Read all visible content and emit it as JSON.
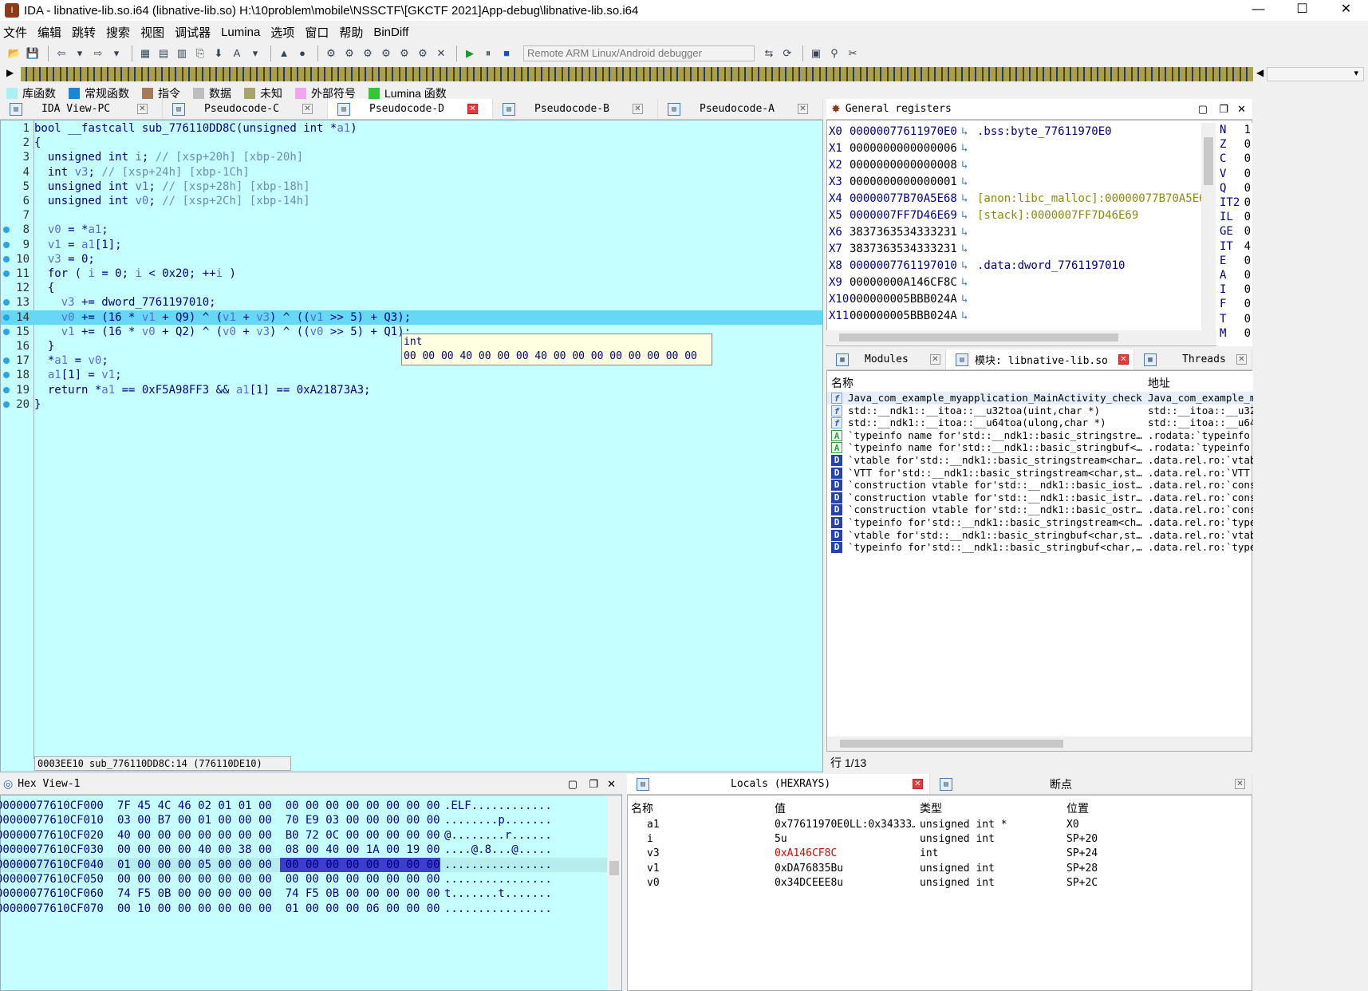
{
  "window": {
    "title": "IDA - libnative-lib.so.i64 (libnative-lib.so) H:\\10problem\\mobile\\NSSCTF\\[GKCTF 2021]App-debug\\libnative-lib.so.i64",
    "minimize": "—",
    "maximize": "☐",
    "close": "✕"
  },
  "menu": [
    "文件",
    "编辑",
    "跳转",
    "搜索",
    "视图",
    "调试器",
    "Lumina",
    "选项",
    "窗口",
    "帮助",
    "BinDiff"
  ],
  "debugger_select": "Remote ARM Linux/Android debugger",
  "legend": [
    {
      "label": "库函数",
      "color": "#aaf0f4"
    },
    {
      "label": "常规函数",
      "color": "#1a86d8"
    },
    {
      "label": "指令",
      "color": "#a67a55"
    },
    {
      "label": "数据",
      "color": "#bdbdbd"
    },
    {
      "label": "未知",
      "color": "#a7a467"
    },
    {
      "label": "外部符号",
      "color": "#f3a4f0"
    },
    {
      "label": "Lumina 函数",
      "color": "#32c832"
    }
  ],
  "code_tabs": [
    {
      "label": "IDA View-PC"
    },
    {
      "label": "Pseudocode-C"
    },
    {
      "label": "Pseudocode-D",
      "active": true
    },
    {
      "label": "Pseudocode-B"
    },
    {
      "label": "Pseudocode-A"
    }
  ],
  "code": {
    "lines": [
      {
        "n": "1",
        "text": "bool __fastcall sub_776110DD8C(unsigned int *a1)"
      },
      {
        "n": "2",
        "text": "{"
      },
      {
        "n": "3",
        "text": "  unsigned int i; // [xsp+20h] [xbp-20h]"
      },
      {
        "n": "4",
        "text": "  int v3; // [xsp+24h] [xbp-1Ch]"
      },
      {
        "n": "5",
        "text": "  unsigned int v1; // [xsp+28h] [xbp-18h]"
      },
      {
        "n": "6",
        "text": "  unsigned int v0; // [xsp+2Ch] [xbp-14h]"
      },
      {
        "n": "7",
        "text": ""
      },
      {
        "n": "8",
        "text": "  v0 = *a1;",
        "bp": true
      },
      {
        "n": "9",
        "text": "  v1 = a1[1];",
        "bp": true
      },
      {
        "n": "10",
        "text": "  v3 = 0;",
        "bp": true
      },
      {
        "n": "11",
        "text": "  for ( i = 0; i < 0x20; ++i )",
        "bp": true
      },
      {
        "n": "12",
        "text": "  {"
      },
      {
        "n": "13",
        "text": "    v3 += dword_7761197010;",
        "bp": true
      },
      {
        "n": "14",
        "text": "    v0 += (16 * v1 + Q9) ^ (v1 + v3) ^ ((v1 >> 5) + Q3);",
        "bp": true,
        "hl": true
      },
      {
        "n": "15",
        "text": "    v1 += (16 * v0 + Q2) ^ (v0 + v3) ^ ((v0 >> 5) + Q1);",
        "bp": true
      },
      {
        "n": "16",
        "text": "  }"
      },
      {
        "n": "17",
        "text": "  *a1 = v0;",
        "bp": true
      },
      {
        "n": "18",
        "text": "  a1[1] = v1;",
        "bp": true
      },
      {
        "n": "19",
        "text": "  return *a1 == 0xF5A98FF3 && a1[1] == 0xA21873A3;",
        "bp": true
      },
      {
        "n": "20",
        "text": "}",
        "bp": true
      }
    ],
    "tooltip_type": "int",
    "tooltip_bytes": "00 00 00 40 00 00 00 40 00 00 00 00 00 00 00 00",
    "status": "0003EE10 sub_776110DD8C:14 (776110DE10)"
  },
  "registers": {
    "title": "General registers",
    "rows": [
      {
        "name": "X0",
        "value": "00000077611970E0",
        "target": ".bss:byte_77611970E0"
      },
      {
        "name": "X1",
        "value": "0000000000000006",
        "target": ""
      },
      {
        "name": "X2",
        "value": "0000000000000008",
        "target": ""
      },
      {
        "name": "X3",
        "value": "0000000000000001",
        "target": ""
      },
      {
        "name": "X4",
        "value": "00000077B70A5E68",
        "target": "[anon:libc_malloc]:00000077B70A5E6"
      },
      {
        "name": "X5",
        "value": "0000007FF7D46E69",
        "target": "[stack]:0000007FF7D46E69"
      },
      {
        "name": "X6",
        "value": "3837363534333231",
        "target": ""
      },
      {
        "name": "X7",
        "value": "3837363534333231",
        "target": ""
      },
      {
        "name": "X8",
        "value": "0000007761197010",
        "target": ".data:dword_7761197010"
      },
      {
        "name": "X9",
        "value": "00000000A146CF8C",
        "target": ""
      },
      {
        "name": "X10",
        "value": "000000005BBB024A",
        "target": ""
      },
      {
        "name": "X11",
        "value": "000000005BBB024A",
        "target": ""
      }
    ],
    "flags": [
      {
        "f": "N",
        "v": "1"
      },
      {
        "f": "Z",
        "v": "0"
      },
      {
        "f": "C",
        "v": "0"
      },
      {
        "f": "V",
        "v": "0"
      },
      {
        "f": "Q",
        "v": "0"
      },
      {
        "f": "IT2",
        "v": "0"
      },
      {
        "f": "IL",
        "v": "0"
      },
      {
        "f": "GE",
        "v": "0"
      },
      {
        "f": "IT",
        "v": "4"
      },
      {
        "f": "E",
        "v": "0"
      },
      {
        "f": "A",
        "v": "0"
      },
      {
        "f": "I",
        "v": "0"
      },
      {
        "f": "F",
        "v": "0"
      },
      {
        "f": "T",
        "v": "0"
      },
      {
        "f": "M",
        "v": "0"
      }
    ]
  },
  "module_tabs": [
    {
      "label": "Modules"
    },
    {
      "label": "模块: libnative-lib.so",
      "active": true
    },
    {
      "label": "Threads"
    }
  ],
  "modules": {
    "col_name": "名称",
    "col_addr": "地址",
    "rows": [
      {
        "icon": "f",
        "name": "Java_com_example_myapplication_MainActivity_check",
        "addr": "Java_com_example_m"
      },
      {
        "icon": "f",
        "name": "std::__ndk1::__itoa::__u32toa(uint,char *)",
        "addr": "std::__itoa::__u32"
      },
      {
        "icon": "f",
        "name": "std::__ndk1::__itoa::__u64toa(ulong,char *)",
        "addr": "std::__itoa::__u64"
      },
      {
        "icon": "A",
        "name": "`typeinfo name for'std::__ndk1::basic_stringstre…",
        "addr": ".rodata:`typeinfo"
      },
      {
        "icon": "A",
        "name": "`typeinfo name for'std::__ndk1::basic_stringbuf<…",
        "addr": ".rodata:`typeinfo"
      },
      {
        "icon": "D",
        "name": "`vtable for'std::__ndk1::basic_stringstream<char…",
        "addr": ".data.rel.ro:`vtab"
      },
      {
        "icon": "D",
        "name": "`VTT for'std::__ndk1::basic_stringstream<char,st…",
        "addr": ".data.rel.ro:`VTT"
      },
      {
        "icon": "D",
        "name": "`construction vtable for'std::__ndk1::basic_iost…",
        "addr": ".data.rel.ro:`cons"
      },
      {
        "icon": "D",
        "name": "`construction vtable for'std::__ndk1::basic_istr…",
        "addr": ".data.rel.ro:`cons"
      },
      {
        "icon": "D",
        "name": "`construction vtable for'std::__ndk1::basic_ostr…",
        "addr": ".data.rel.ro:`cons"
      },
      {
        "icon": "D",
        "name": "`typeinfo for'std::__ndk1::basic_stringstream<ch…",
        "addr": ".data.rel.ro:`type"
      },
      {
        "icon": "D",
        "name": "`vtable for'std::__ndk1::basic_stringbuf<char,st…",
        "addr": ".data.rel.ro:`vtab"
      },
      {
        "icon": "D",
        "name": "`typeinfo for'std::__ndk1::basic_stringbuf<char,…",
        "addr": ".data.rel.ro:`type"
      }
    ],
    "footer": "行 1/13"
  },
  "hex": {
    "title": "Hex View-1",
    "rows": [
      {
        "addr": "00000077610CF000",
        "bytes": "7F 45 4C 46 02 01 01 00  00 00 00 00 00 00 00 00",
        "ascii": ".ELF............"
      },
      {
        "addr": "00000077610CF010",
        "bytes": "03 00 B7 00 01 00 00 00  70 E9 03 00 00 00 00 00",
        "ascii": "........p......."
      },
      {
        "addr": "00000077610CF020",
        "bytes": "40 00 00 00 00 00 00 00  B0 72 0C 00 00 00 00 00",
        "ascii": "@........r......"
      },
      {
        "addr": "00000077610CF030",
        "bytes": "00 00 00 00 40 00 38 00  08 00 40 00 1A 00 19 00",
        "ascii": "....@.8...@....."
      },
      {
        "addr": "00000077610CF040",
        "bytes": "01 00 00 00 05 00 00 00  00 00 00 00 00 00 00 00",
        "ascii": "................",
        "hl": true
      },
      {
        "addr": "00000077610CF050",
        "bytes": "00 00 00 00 00 00 00 00  00 00 00 00 00 00 00 00",
        "ascii": "................"
      },
      {
        "addr": "00000077610CF060",
        "bytes": "74 F5 0B 00 00 00 00 00  74 F5 0B 00 00 00 00 00",
        "ascii": "t.......t......."
      },
      {
        "addr": "00000077610CF070",
        "bytes": "00 10 00 00 00 00 00 00  01 00 00 00 06 00 00 00",
        "ascii": "................"
      }
    ]
  },
  "locals_tabs": [
    {
      "label": "Locals (HEXRAYS)",
      "active": true
    },
    {
      "label": "断点"
    }
  ],
  "locals": {
    "cols": [
      "名称",
      "值",
      "类型",
      "位置"
    ],
    "rows": [
      {
        "name": "a1",
        "value": "0x77611970E0LL:0x34333…",
        "type": "unsigned int *",
        "loc": "X0"
      },
      {
        "name": "i",
        "value": "5u",
        "type": "unsigned int",
        "loc": "SP+20"
      },
      {
        "name": "v3",
        "value": "0xA146CF8C",
        "type": "int",
        "loc": "SP+24",
        "red": true
      },
      {
        "name": "v1",
        "value": "0xDA76835Bu",
        "type": "unsigned int",
        "loc": "SP+28"
      },
      {
        "name": "v0",
        "value": "0x34DCEEE8u",
        "type": "unsigned int",
        "loc": "SP+2C"
      }
    ]
  }
}
